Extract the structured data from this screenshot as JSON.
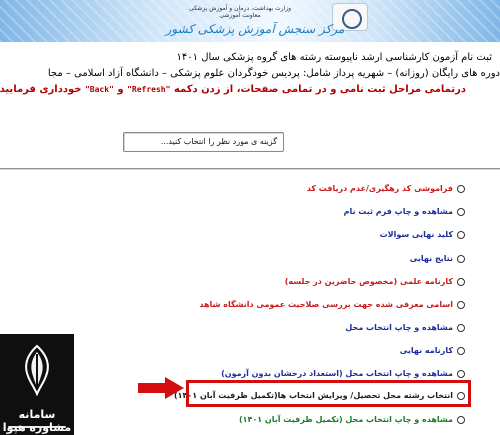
{
  "header": {
    "ministry_lines": [
      "وزارت بهداشت، درمان و آموزش پزشکی",
      "معاونت آموزشی"
    ],
    "center_title": "مرکز سنجش آموزش پزشکی کشور"
  },
  "info": {
    "line1": "ثبت نام آزمون کارشناسی ارشد ناپیوسته رشته های گروه پزشکی سال ۱۴۰۱",
    "line2": "دوره های رایگان (روزانه) – شهریه پرداز شامل: پردیس خودگردان علوم پزشکی – دانشگاه آزاد اسلامی – مجا",
    "line3_prefix": "درتمامی مراحل ثبت نامی و در تمامی صفحات، از زدن دکمه",
    "refresh": "\"Refresh\"",
    "and": "و",
    "back": "\"Back\"",
    "line3_suffix": "خودداری فرمایید ."
  },
  "chooser": {
    "label": "گزینه ی مورد نظر را انتخاب کنید..."
  },
  "menu": [
    {
      "label": "فراموشی کد رهگیری/عدم دریافت کد",
      "color": "red"
    },
    {
      "label": "مشاهده و چاپ فرم ثبت نام",
      "color": "blue"
    },
    {
      "label": "کلید نهایی سوالات",
      "color": "blue"
    },
    {
      "label": "نتایج نهایی",
      "color": "blue"
    },
    {
      "label": "کارنامه علمی (مخصوص حاضرین در جلسه)",
      "color": "red"
    },
    {
      "label": "اسامی معرفی شده جهت بررسی صلاحیت عمومی دانشگاه شاهد",
      "color": "red"
    },
    {
      "label": "مشاهده و چاپ انتخاب محل",
      "color": "blue"
    },
    {
      "label": "کارنامه نهایی",
      "color": "blue"
    },
    {
      "label": "مشاهده و چاپ انتخاب محل (استعداد درخشان بدون آزمون)",
      "color": "blue"
    },
    {
      "label": "انتخاب رشته محل تحصیل/ ویرایش انتخاب ها(تکمیل ظرفیت آبان ۱۴۰۱)",
      "color": "dark"
    },
    {
      "label": "مشاهده و چاپ انتخاب محل (تکمیل ظرفیت آبان ۱۴۰۱)",
      "color": "green"
    }
  ],
  "watermark": {
    "text": "سامانه مشاوره هپوا"
  },
  "colors": {
    "red": "#c81b1b",
    "blue": "#1b2e9a",
    "green": "#1e7a29",
    "highlight": "#d40e0e"
  }
}
